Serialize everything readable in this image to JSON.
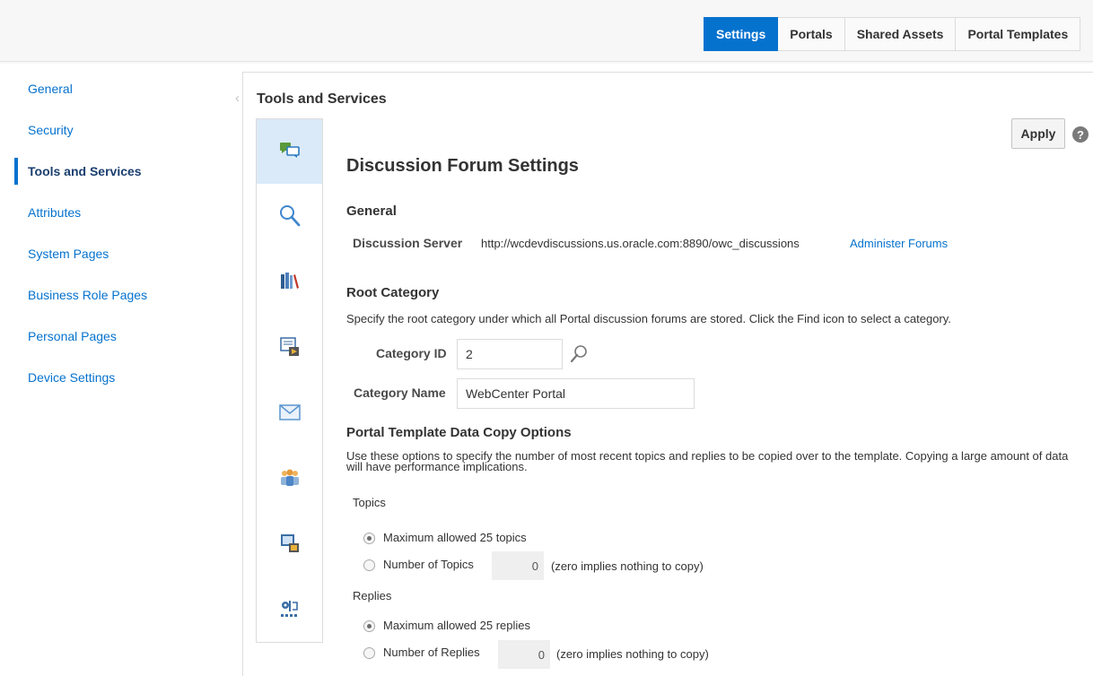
{
  "top_tabs": [
    {
      "label": "Settings",
      "active": true
    },
    {
      "label": "Portals"
    },
    {
      "label": "Shared Assets"
    },
    {
      "label": "Portal Templates"
    }
  ],
  "left_nav": [
    {
      "label": "General"
    },
    {
      "label": "Security"
    },
    {
      "label": "Tools and Services",
      "active": true
    },
    {
      "label": "Attributes"
    },
    {
      "label": "System Pages"
    },
    {
      "label": "Business Role Pages"
    },
    {
      "label": "Personal Pages"
    },
    {
      "label": "Device Settings"
    }
  ],
  "section_title": "Tools and Services",
  "rail_icons": [
    "discussions-icon",
    "search-icon",
    "library-icon",
    "document-icon",
    "mail-icon",
    "people-icon",
    "presence-icon",
    "connections-icon"
  ],
  "toolbar": {
    "apply_label": "Apply",
    "help_glyph": "?"
  },
  "forum": {
    "title": "Discussion Forum Settings",
    "general_heading": "General",
    "server_label": "Discussion Server",
    "server_url": "http://wcdevdiscussions.us.oracle.com:8890/owc_discussions",
    "administer_link": "Administer Forums",
    "root_heading": "Root Category",
    "root_desc": "Specify the root category under which all Portal discussion forums are stored. Click the Find icon to select a category.",
    "category_id_label": "Category ID",
    "category_id_value": "2",
    "category_name_label": "Category Name",
    "category_name_value": "WebCenter Portal",
    "copy_heading": "Portal Template Data Copy Options",
    "copy_desc": "Use these options to specify the number of most recent topics and replies to be copied over to the template. Copying a large amount of data will have performance implications.",
    "topics_label": "Topics",
    "topics_max_label": "Maximum allowed 25 topics",
    "topics_num_label": "Number of Topics",
    "topics_num_value": "0",
    "topics_hint": "(zero implies nothing to copy)",
    "replies_label": "Replies",
    "replies_max_label": "Maximum allowed 25 replies",
    "replies_num_label": "Number of Replies",
    "replies_num_value": "0",
    "replies_hint": "(zero implies nothing to copy)"
  },
  "colors": {
    "accent": "#0572ce",
    "rail_active": "#dbeaf8"
  }
}
